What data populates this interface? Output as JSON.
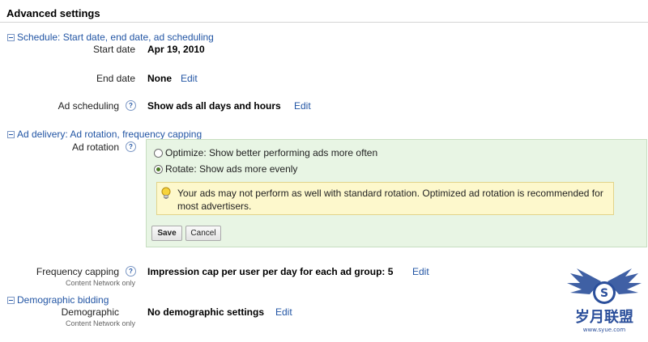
{
  "page_title": "Advanced settings",
  "sections": {
    "schedule": {
      "header": "Schedule: Start date, end date, ad scheduling",
      "start_date_label": "Start date",
      "start_date_value": "Apr 19, 2010",
      "end_date_label": "End date",
      "end_date_value": "None",
      "end_date_edit": "Edit",
      "ad_scheduling_label": "Ad scheduling",
      "ad_scheduling_value": "Show ads all days and hours",
      "ad_scheduling_edit": "Edit"
    },
    "ad_delivery": {
      "header": "Ad delivery: Ad rotation, frequency capping",
      "ad_rotation_label": "Ad rotation",
      "options": [
        {
          "label": "Optimize: Show better performing ads more often",
          "selected": false
        },
        {
          "label": "Rotate: Show ads more evenly",
          "selected": true
        }
      ],
      "notice": "Your ads may not perform as well with standard rotation. Optimized ad rotation is recommended for most advertisers.",
      "save_label": "Save",
      "cancel_label": "Cancel",
      "frequency_label": "Frequency capping",
      "frequency_sublabel": "Content Network only",
      "frequency_value": "Impression cap per user per day for each ad group: 5",
      "frequency_edit": "Edit"
    },
    "demographic": {
      "header": "Demographic bidding",
      "demographic_label": "Demographic",
      "demographic_sublabel": "Content Network only",
      "demographic_value": "No demographic settings",
      "demographic_edit": "Edit"
    }
  },
  "watermark": {
    "badge_letter": "S",
    "brand_text": "岁月联盟",
    "url_text": "www.syue.com"
  },
  "colors": {
    "link": "#2255a4",
    "panel_bg": "#e8f5e4",
    "notice_bg": "#fdf8cc",
    "watermark": "#2b4f9b"
  }
}
